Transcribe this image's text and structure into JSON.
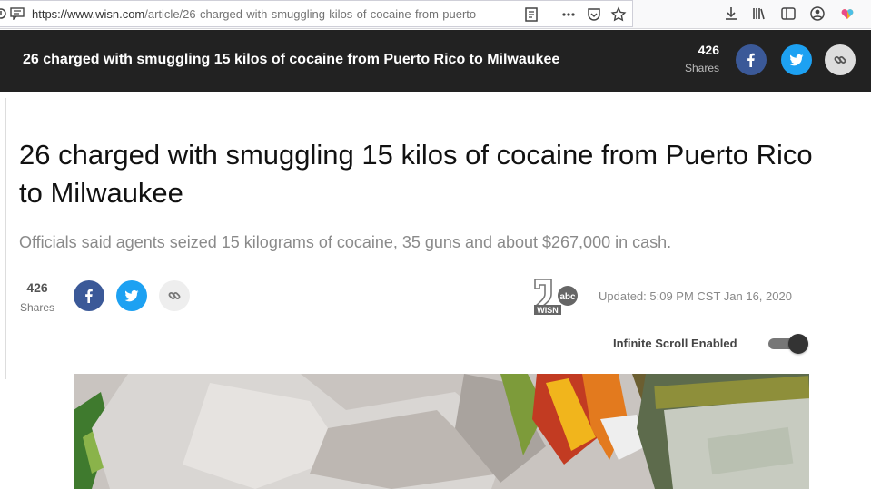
{
  "browser": {
    "url_main": "https://www.wisn.com",
    "url_path": "/article/26-charged-with-smuggling-kilos-of-cocaine-from-puerto"
  },
  "sticky": {
    "title": "26 charged with smuggling 15 kilos of cocaine from Puerto Rico to Milwaukee",
    "share_count": "426",
    "shares_label": "Shares"
  },
  "article": {
    "headline": "26 charged with smuggling 15 kilos of cocaine from Puerto Rico to Milwaukee",
    "dek": "Officials said agents seized 15 kilograms of cocaine, 35 guns and about $267,000 in cash.",
    "share_count": "426",
    "shares_label": "Shares",
    "logo_text": "WISN",
    "logo_badge": "abc",
    "updated": "Updated: 5:09 PM CST Jan 16, 2020",
    "infinite_scroll_label": "Infinite Scroll Enabled"
  },
  "colors": {
    "facebook": "#3b5998",
    "twitter": "#1da1f2",
    "sticky_bg": "#222222"
  }
}
